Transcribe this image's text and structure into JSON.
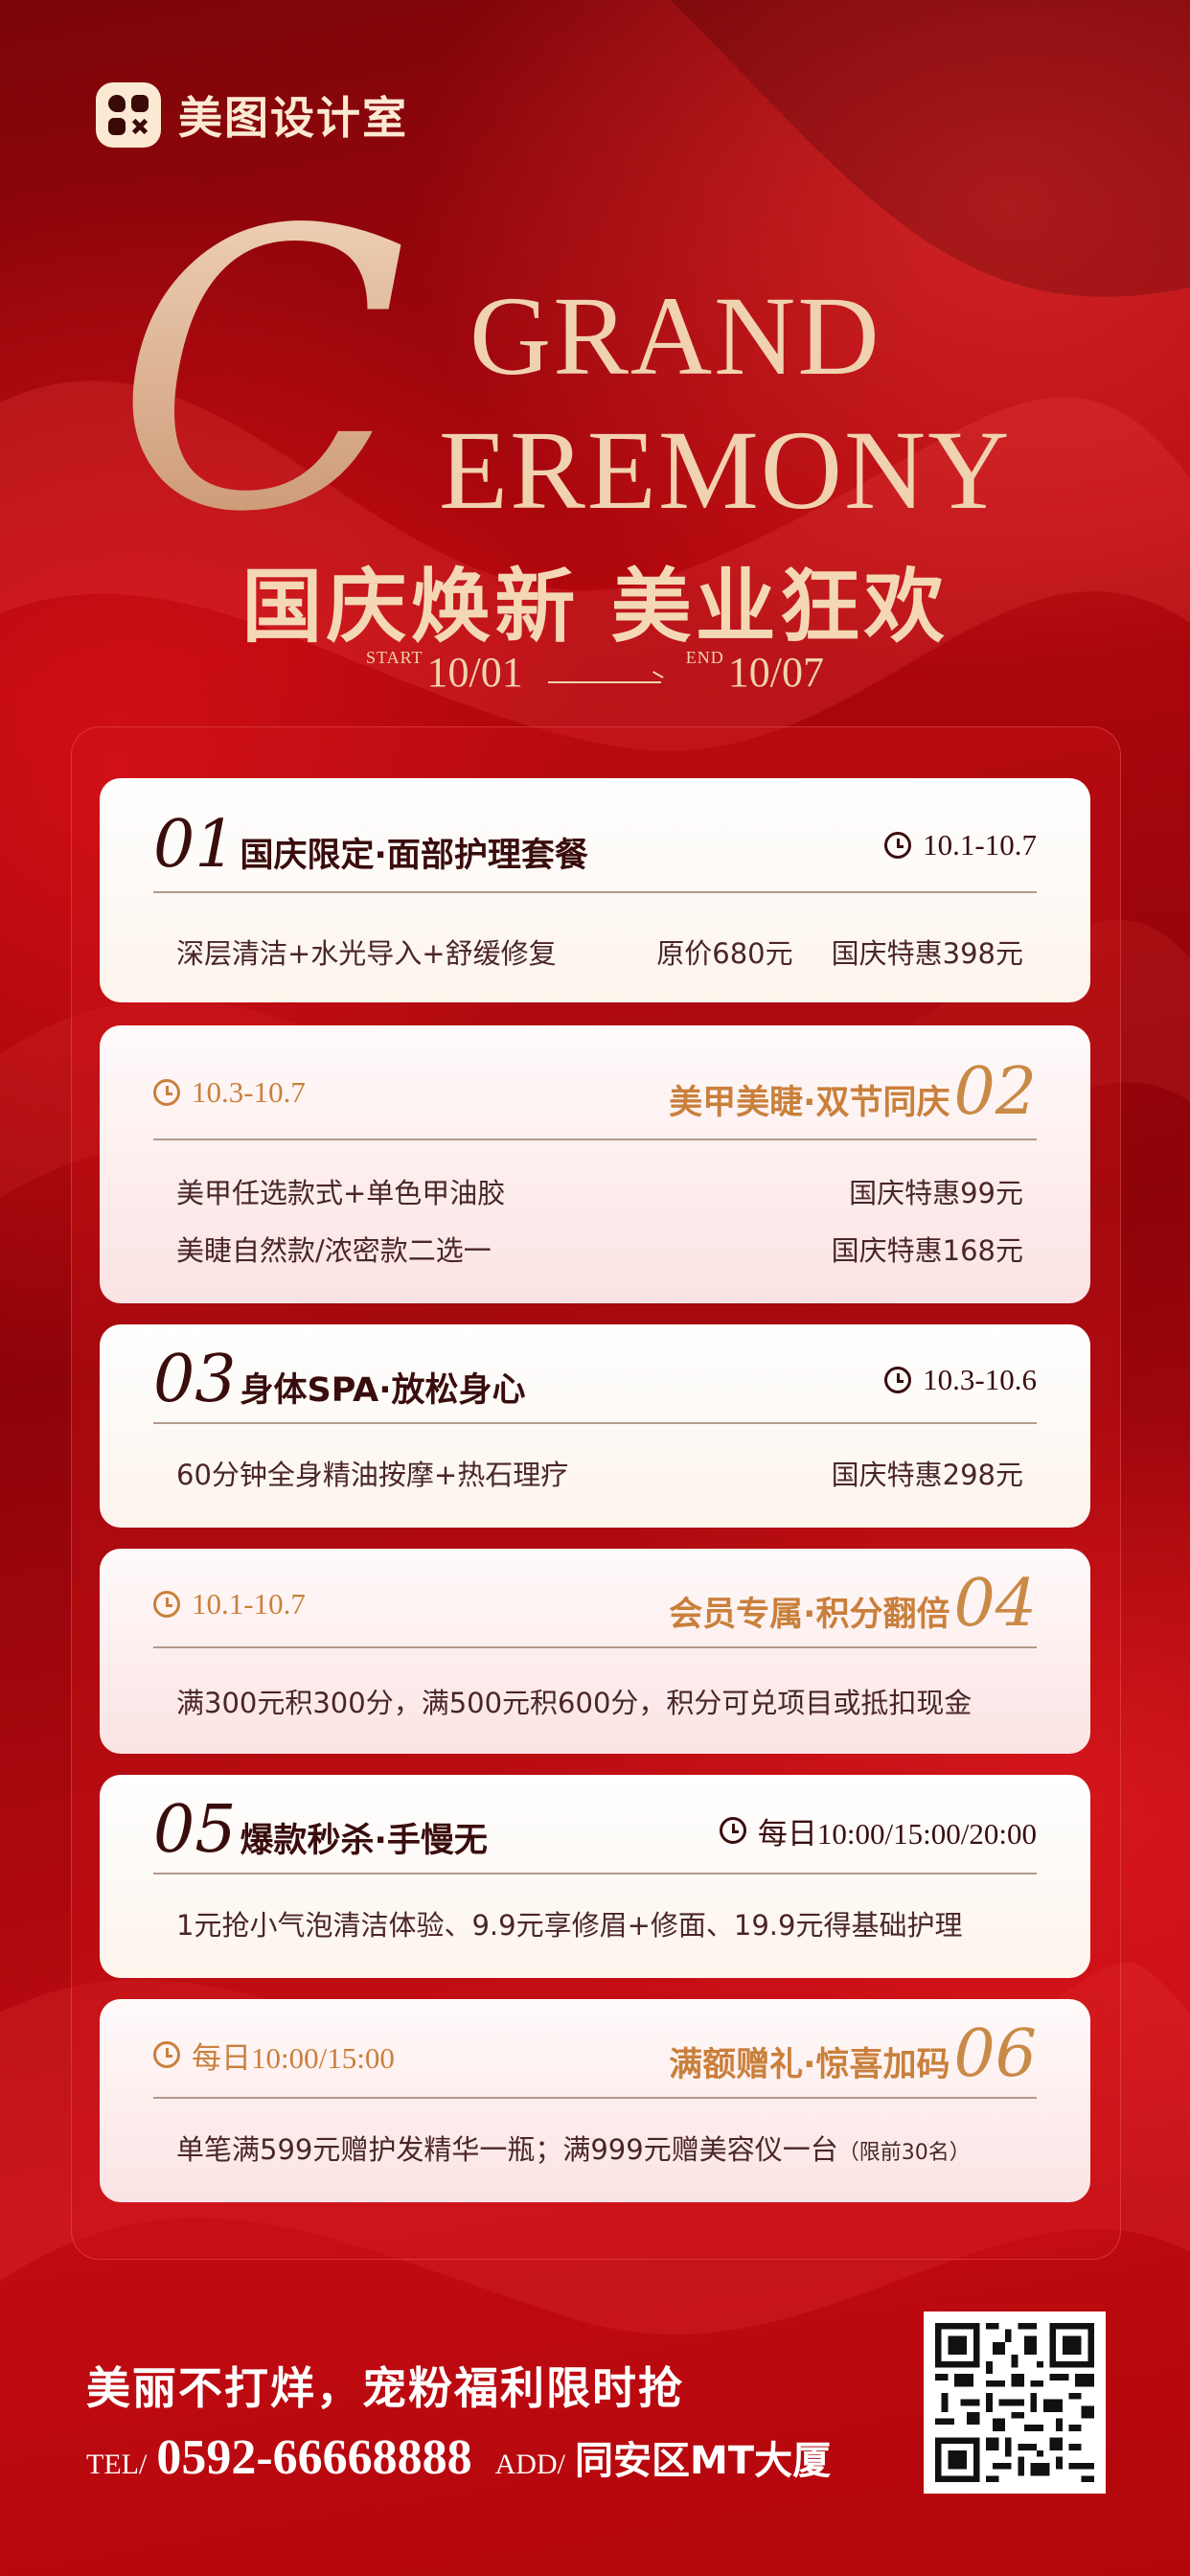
{
  "brand": {
    "name": "美图设计室"
  },
  "header": {
    "big_letter": "C",
    "line1": "GRAND",
    "line2": "EREMONY",
    "headline": "国庆焕新 美业狂欢",
    "start_tag": "START",
    "start_date": "10/01",
    "end_tag": "END",
    "end_date": "10/07"
  },
  "cards": [
    {
      "num": "01",
      "title": "国庆限定·面部护理套餐",
      "time": "10.1-10.7",
      "rows": [
        {
          "left": "深层清洁+水光导入+舒缓修复",
          "mid": "原价680元",
          "right": "国庆特惠398元"
        }
      ]
    },
    {
      "num": "02",
      "title": "美甲美睫·双节同庆",
      "time": "10.3-10.7",
      "rows": [
        {
          "left": "美甲任选款式+单色甲油胶",
          "right": "国庆特惠99元"
        },
        {
          "left": "美睫自然款/浓密款二选一",
          "right": "国庆特惠168元"
        }
      ]
    },
    {
      "num": "03",
      "title": "身体SPA·放松身心",
      "time": "10.3-10.6",
      "rows": [
        {
          "left": "60分钟全身精油按摩+热石理疗",
          "right": "国庆特惠298元"
        }
      ]
    },
    {
      "num": "04",
      "title": "会员专属·积分翻倍",
      "time": "10.1-10.7",
      "rows": [
        {
          "left": "满300元积300分，满500元积600分，积分可兑项目或抵扣现金"
        }
      ]
    },
    {
      "num": "05",
      "title": "爆款秒杀·手慢无",
      "time": "每日10:00/15:00/20:00",
      "rows": [
        {
          "left": "1元抢小气泡清洁体验、9.9元享修眉+修面、19.9元得基础护理"
        }
      ]
    },
    {
      "num": "06",
      "title": "满额赠礼·惊喜加码",
      "time": "每日10:00/15:00",
      "rows": [
        {
          "left": "单笔满599元赠护发精华一瓶；满999元赠美容仪一台",
          "note": "（限前30名）"
        }
      ]
    }
  ],
  "footer": {
    "slogan": "美丽不打烊，宠粉福利限时抢",
    "tel_label": "TEL/",
    "tel": "0592-66668888",
    "add_label": "ADD/",
    "address": "同安区MT大厦"
  },
  "colors": {
    "bg": "#b1070d",
    "gold": "#c9803c",
    "dark": "#3a0d0d",
    "cream": "#f0d2b0"
  }
}
